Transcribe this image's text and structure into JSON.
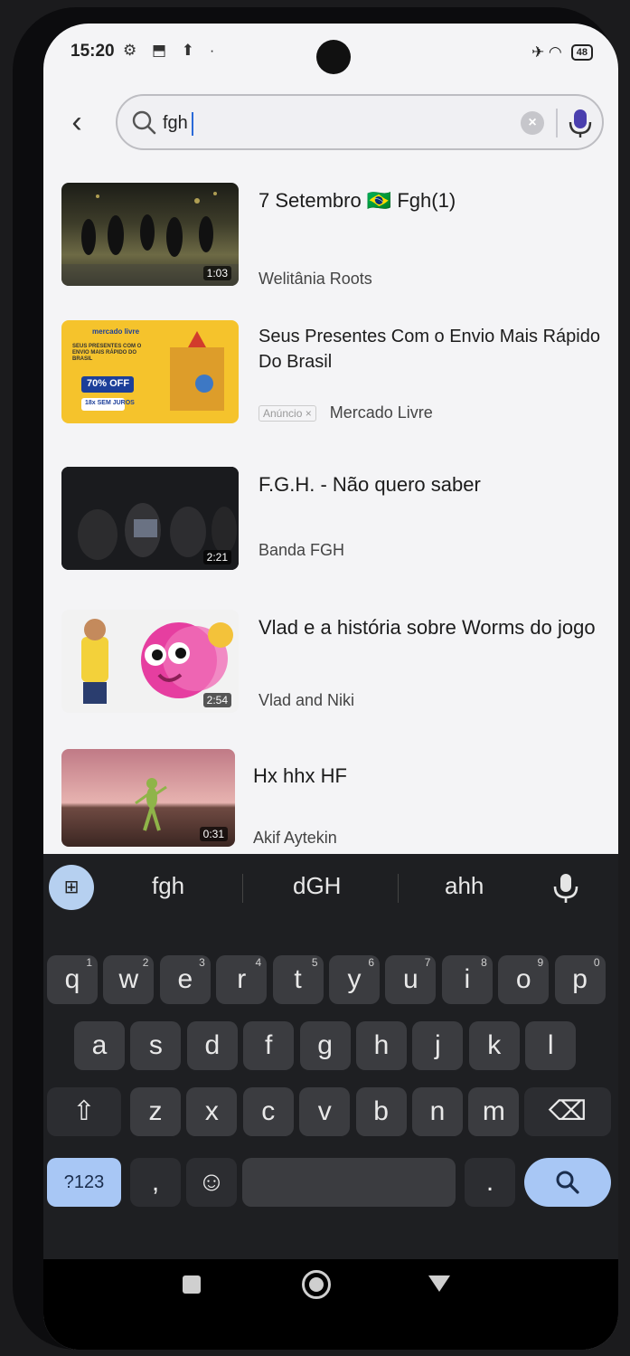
{
  "status_bar": {
    "time": "15:20",
    "left_icons": "⚙ ⬒ ⬆ ·",
    "right_icons": "✈ ◠",
    "battery": "48"
  },
  "search": {
    "query": "fgh",
    "clear_label": "×"
  },
  "results": [
    {
      "title": "7 Setembro 🇧🇷 Fgh(1)",
      "channel": "Welitânia Roots",
      "duration": "1:03",
      "is_ad": false
    },
    {
      "title": "Seus Presentes Com o Envio Mais Rápido Do Brasil",
      "channel": "Mercado Livre",
      "ad_label": "Anúncio ×",
      "is_ad": true,
      "thumb_text": {
        "brand": "mercado livre",
        "promo": "SEUS PRESENTES COM O ENVIO MAIS RÁPIDO DO BRASIL",
        "discount": "70% OFF",
        "installments": "18x SEM JUROS"
      }
    },
    {
      "title": "F.G.H. - Não quero saber",
      "channel": "Banda FGH",
      "duration": "2:21",
      "is_ad": false
    },
    {
      "title": "Vlad e a história sobre Worms do jogo",
      "channel": "Vlad and Niki",
      "duration": "2:54",
      "is_ad": false
    },
    {
      "title": "Hx hhx HF",
      "channel": "Akif Aytekin",
      "duration": "0:31",
      "is_ad": false
    }
  ],
  "keyboard": {
    "suggestions": [
      "fgh",
      "dGH",
      "ahh"
    ],
    "row1": [
      {
        "k": "q",
        "h": "1"
      },
      {
        "k": "w",
        "h": "2"
      },
      {
        "k": "e",
        "h": "3"
      },
      {
        "k": "r",
        "h": "4"
      },
      {
        "k": "t",
        "h": "5"
      },
      {
        "k": "y",
        "h": "6"
      },
      {
        "k": "u",
        "h": "7"
      },
      {
        "k": "i",
        "h": "8"
      },
      {
        "k": "o",
        "h": "9"
      },
      {
        "k": "p",
        "h": "0"
      }
    ],
    "row2": [
      "a",
      "s",
      "d",
      "f",
      "g",
      "h",
      "j",
      "k",
      "l"
    ],
    "row3": [
      "z",
      "x",
      "c",
      "v",
      "b",
      "n",
      "m"
    ],
    "symbols_label": "?123",
    "comma": ",",
    "period": "."
  },
  "colors": {
    "keyboard_bg": "#1e1f22",
    "key_bg": "#3b3c40",
    "accent_blue": "#a8c7f5",
    "screen_bg": "#f4f4f6"
  }
}
